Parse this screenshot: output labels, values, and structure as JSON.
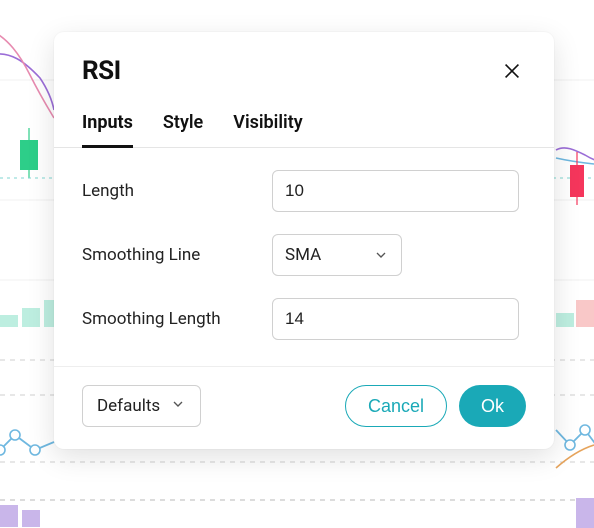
{
  "modal": {
    "title": "RSI",
    "tabs": {
      "inputs": "Inputs",
      "style": "Style",
      "visibility": "Visibility"
    },
    "fields": {
      "length": {
        "label": "Length",
        "value": "10"
      },
      "smoothing_line": {
        "label": "Smoothing Line",
        "value": "SMA"
      },
      "smoothing_length": {
        "label": "Smoothing Length",
        "value": "14"
      }
    },
    "footer": {
      "defaults": "Defaults",
      "cancel": "Cancel",
      "ok": "Ok"
    }
  },
  "colors": {
    "accent": "#1aa9b7",
    "candle_green": "#2dce89",
    "candle_red": "#f5365c",
    "line_purple": "#9b6dd7",
    "line_pink": "#e78bb0",
    "line_blue": "#6fb8e0",
    "dashed_teal": "#7fd6d0",
    "grid": "#f0f0f0"
  }
}
